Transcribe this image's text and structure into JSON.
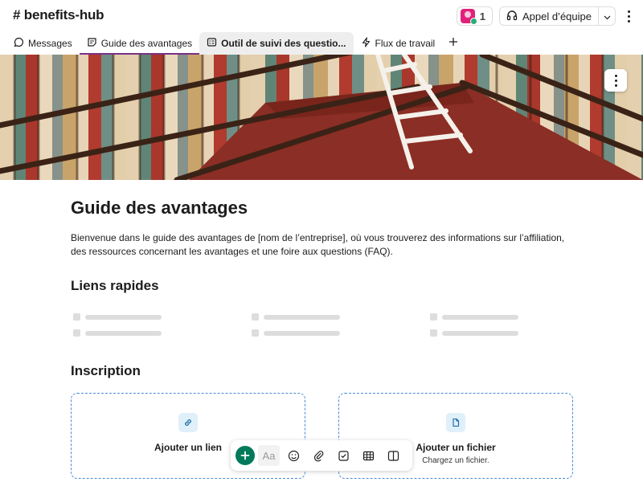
{
  "header": {
    "channel_title": "# benefits-hub",
    "member_count": "1",
    "huddle_label": "Appel d’équipe"
  },
  "tabs": [
    {
      "label": "Messages",
      "icon": "message-bubble-icon"
    },
    {
      "label": "Guide des avantages",
      "icon": "canvas-doc-icon",
      "active": true
    },
    {
      "label": "Outil de suivi des questio...",
      "icon": "list-tracker-icon"
    },
    {
      "label": "Flux de travail",
      "icon": "lightning-icon"
    }
  ],
  "document": {
    "title": "Guide des avantages",
    "intro": "Bienvenue dans le guide des avantages de [nom de l’entreprise], où vous trouverez des informations sur l’affiliation, des ressources concernant les avantages et une foire aux questions (FAQ).",
    "quick_links_heading": "Liens rapides",
    "signup_heading": "Inscription",
    "cards": [
      {
        "title": "Ajouter un lien",
        "subtitle": "",
        "icon": "link-icon"
      },
      {
        "title": "Ajouter un fichier",
        "subtitle": "Chargez un fichier.",
        "icon": "file-icon"
      }
    ]
  },
  "toolbar": {
    "aa_label": "Aa",
    "items": [
      "add-icon",
      "text-format-icon",
      "emoji-icon",
      "attachment-icon",
      "checklist-icon",
      "table-icon",
      "columns-icon"
    ]
  },
  "colors": {
    "accent_tab": "#7c3085",
    "add_button": "#007a5a",
    "card_border": "#4a8bd4",
    "banner_floor": "#8b2e25"
  }
}
